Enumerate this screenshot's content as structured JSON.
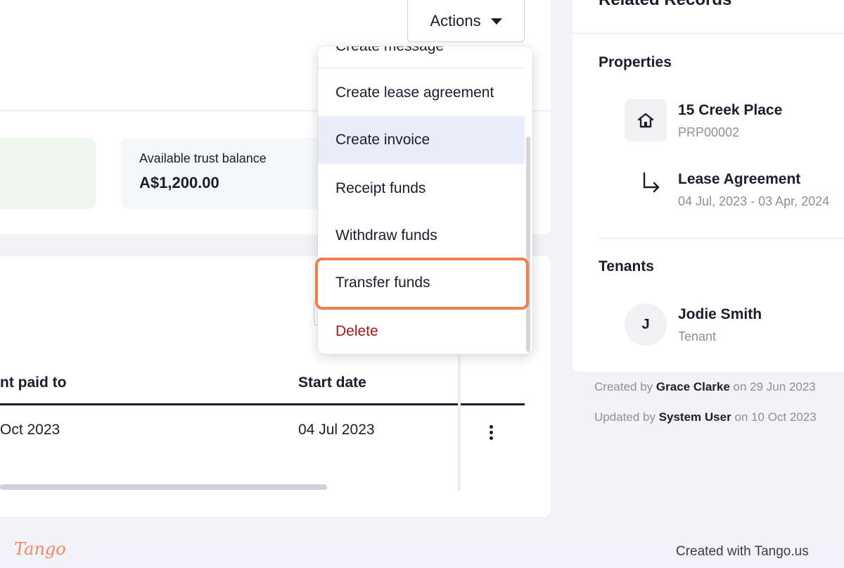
{
  "actions": {
    "label": "Actions"
  },
  "balances": {
    "trust_label": "Available trust balance",
    "trust_value": "A$1,200.00"
  },
  "menu": {
    "items": [
      {
        "label": "Create message"
      },
      {
        "label": "Create lease agreement"
      },
      {
        "label": "Create invoice"
      },
      {
        "label": "Receipt funds"
      },
      {
        "label": "Withdraw funds"
      },
      {
        "label": "Transfer funds"
      },
      {
        "label": "Delete"
      }
    ],
    "hover_bg": "#e9edfa",
    "danger_color": "#a6191c",
    "highlight_color": "#ee7f4f"
  },
  "table": {
    "columns": [
      "nt paid to",
      "Start date"
    ],
    "rows": [
      {
        "paid_to": "Oct 2023",
        "start_date": "04 Jul 2023"
      }
    ]
  },
  "related": {
    "title": "Related Records",
    "properties_title": "Properties",
    "property": {
      "name": "15 Creek Place",
      "code": "PRP00002",
      "icon": "house-icon"
    },
    "lease": {
      "name": "Lease Agreement",
      "dates": "04 Jul, 2023 - 03 Apr, 2024",
      "icon": "arrow-down-right-icon"
    },
    "tenants_title": "Tenants",
    "tenant": {
      "initial": "J",
      "name": "Jodie Smith",
      "role": "Tenant"
    }
  },
  "meta": {
    "created_prefix": "Created by",
    "created_by": "Grace Clarke",
    "created_on": "on 29 Jun 2023",
    "updated_prefix": "Updated by",
    "updated_by": "System User",
    "updated_on": "on 10 Oct 2023"
  },
  "footer": {
    "logo": "Tango",
    "text": "Created with Tango.us"
  }
}
